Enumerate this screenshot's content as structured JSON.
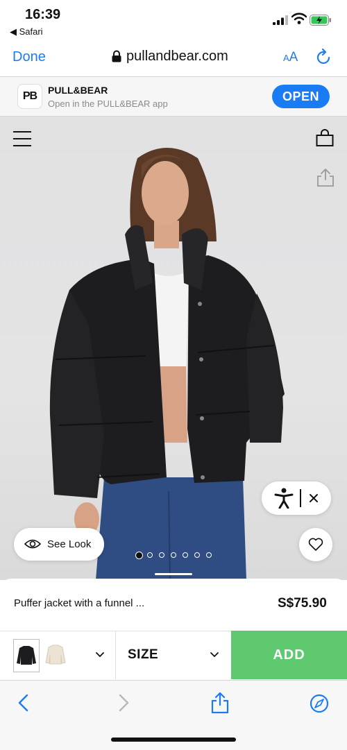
{
  "status_bar": {
    "time": "16:39",
    "back_to_app": "◀ Safari"
  },
  "browser": {
    "done_label": "Done",
    "url": "pullandbear.com",
    "text_size_label": "AA"
  },
  "app_banner": {
    "logo_text": "PB",
    "app_name": "PULL&BEAR",
    "subtitle": "Open in the PULL&BEAR app",
    "open_label": "OPEN"
  },
  "hero": {
    "see_look_label": "See Look",
    "carousel_total": 7,
    "carousel_active": 0
  },
  "product": {
    "name": "Puffer jacket with a funnel ...",
    "price": "S$75.90",
    "size_label": "SIZE",
    "add_label": "ADD"
  },
  "colors": {
    "accent": "#1a7cf5",
    "add_button": "#5ec96f"
  }
}
